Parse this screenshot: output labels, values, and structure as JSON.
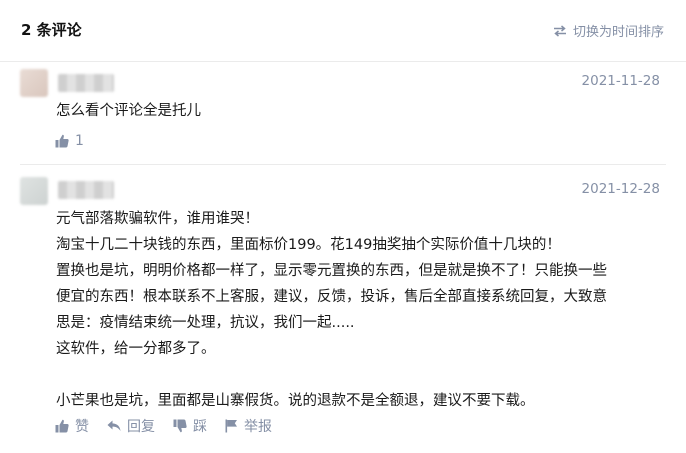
{
  "header": {
    "title": "2 条评论",
    "sort_label": "切换为时间排序"
  },
  "comments": [
    {
      "date": "2021-11-28",
      "lines": [
        "怎么看个评论全是托儿"
      ],
      "like_count": "1"
    },
    {
      "date": "2021-12-28",
      "lines": [
        "元气部落欺骗软件，谁用谁哭！",
        "淘宝十几二十块钱的东西，里面标价199。花149抽奖抽个实际价值十几块的！",
        "置换也是坑，明明价格都一样了，显示零元置换的东西，但是就是换不了！只能换一些",
        "便宜的东西！根本联系不上客服，建议，反馈，投诉，售后全部直接系统回复，大致意",
        "思是：疫情结束统一处理，抗议，我们一起.....",
        "这软件，给一分都多了。",
        "",
        "小芒果也是坑，里面都是山寨假货。说的退款不是全额退，建议不要下载。"
      ],
      "actions": {
        "like": "赞",
        "reply": "回复",
        "dislike": "踩",
        "report": "举报"
      }
    }
  ],
  "icons": {
    "sort": "swap-arrows-icon",
    "like": "thumbs-up-icon",
    "reply": "reply-arrow-icon",
    "dislike": "thumbs-down-icon",
    "report": "flag-icon"
  },
  "colors": {
    "meta_gray": "#8590a6",
    "text": "#1a1a1a",
    "divider": "#ebebeb"
  }
}
